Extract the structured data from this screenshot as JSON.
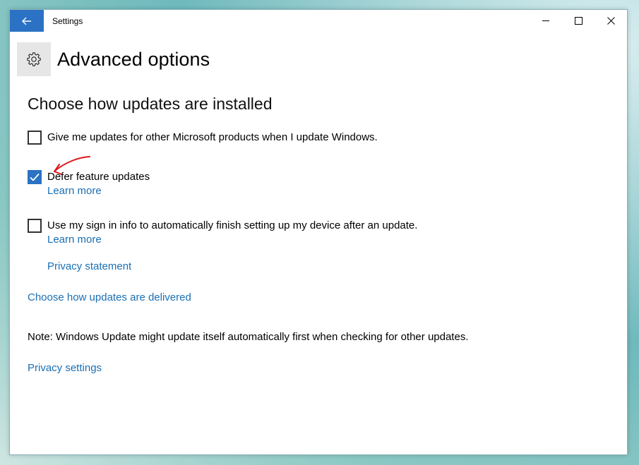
{
  "window": {
    "title": "Settings",
    "back_icon": "arrow-left-icon",
    "minimize_icon": "minimize-icon",
    "maximize_icon": "maximize-icon",
    "close_icon": "close-icon",
    "accent_color": "#2b72c4"
  },
  "header": {
    "icon": "gear-icon",
    "title": "Advanced options"
  },
  "section": {
    "title": "Choose how updates are installed"
  },
  "options": [
    {
      "label": "Give me updates for other Microsoft products when I update Windows.",
      "checked": false
    },
    {
      "label": "Defer feature updates",
      "checked": true,
      "link": "Learn more"
    },
    {
      "label": "Use my sign in info to automatically finish setting up my device after an update.",
      "checked": false,
      "link": "Learn more"
    }
  ],
  "links": {
    "privacy_statement": "Privacy statement",
    "delivery": "Choose how updates are delivered",
    "privacy_settings": "Privacy settings",
    "link_color": "#1a6fb4"
  },
  "note": "Note: Windows Update might update itself automatically first when checking for other updates.",
  "annotation": {
    "type": "red-arrow",
    "color": "#e0151b"
  }
}
